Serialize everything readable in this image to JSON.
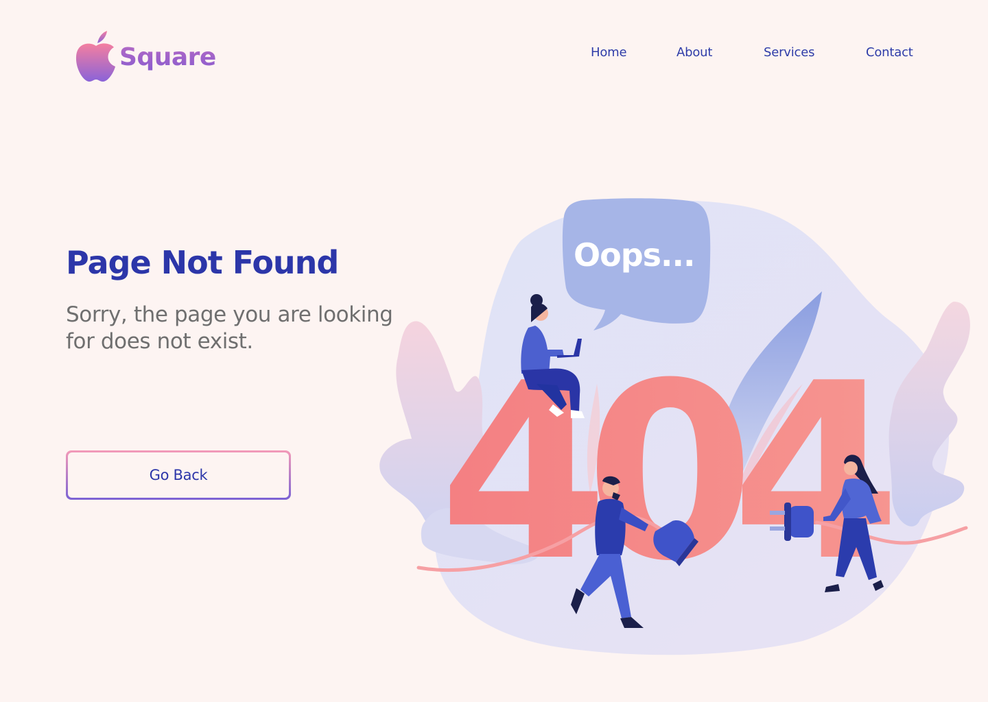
{
  "brand": {
    "name": "Square",
    "logo_icon": "apple-icon"
  },
  "nav": {
    "items": [
      {
        "label": "Home"
      },
      {
        "label": "About"
      },
      {
        "label": "Services"
      },
      {
        "label": "Contact"
      }
    ]
  },
  "main": {
    "title": "Page Not Found",
    "message": "Sorry, the page you are looking for does not exist.",
    "button_label": "Go Back"
  },
  "illustration": {
    "bubble_text": "Oops...",
    "error_code": "404"
  },
  "colors": {
    "background": "#fdf4f2",
    "primary": "#2c36a9",
    "text_muted": "#6f6f6f",
    "accent_pink": "#f48a87",
    "accent_purple": "#7b62d4"
  }
}
